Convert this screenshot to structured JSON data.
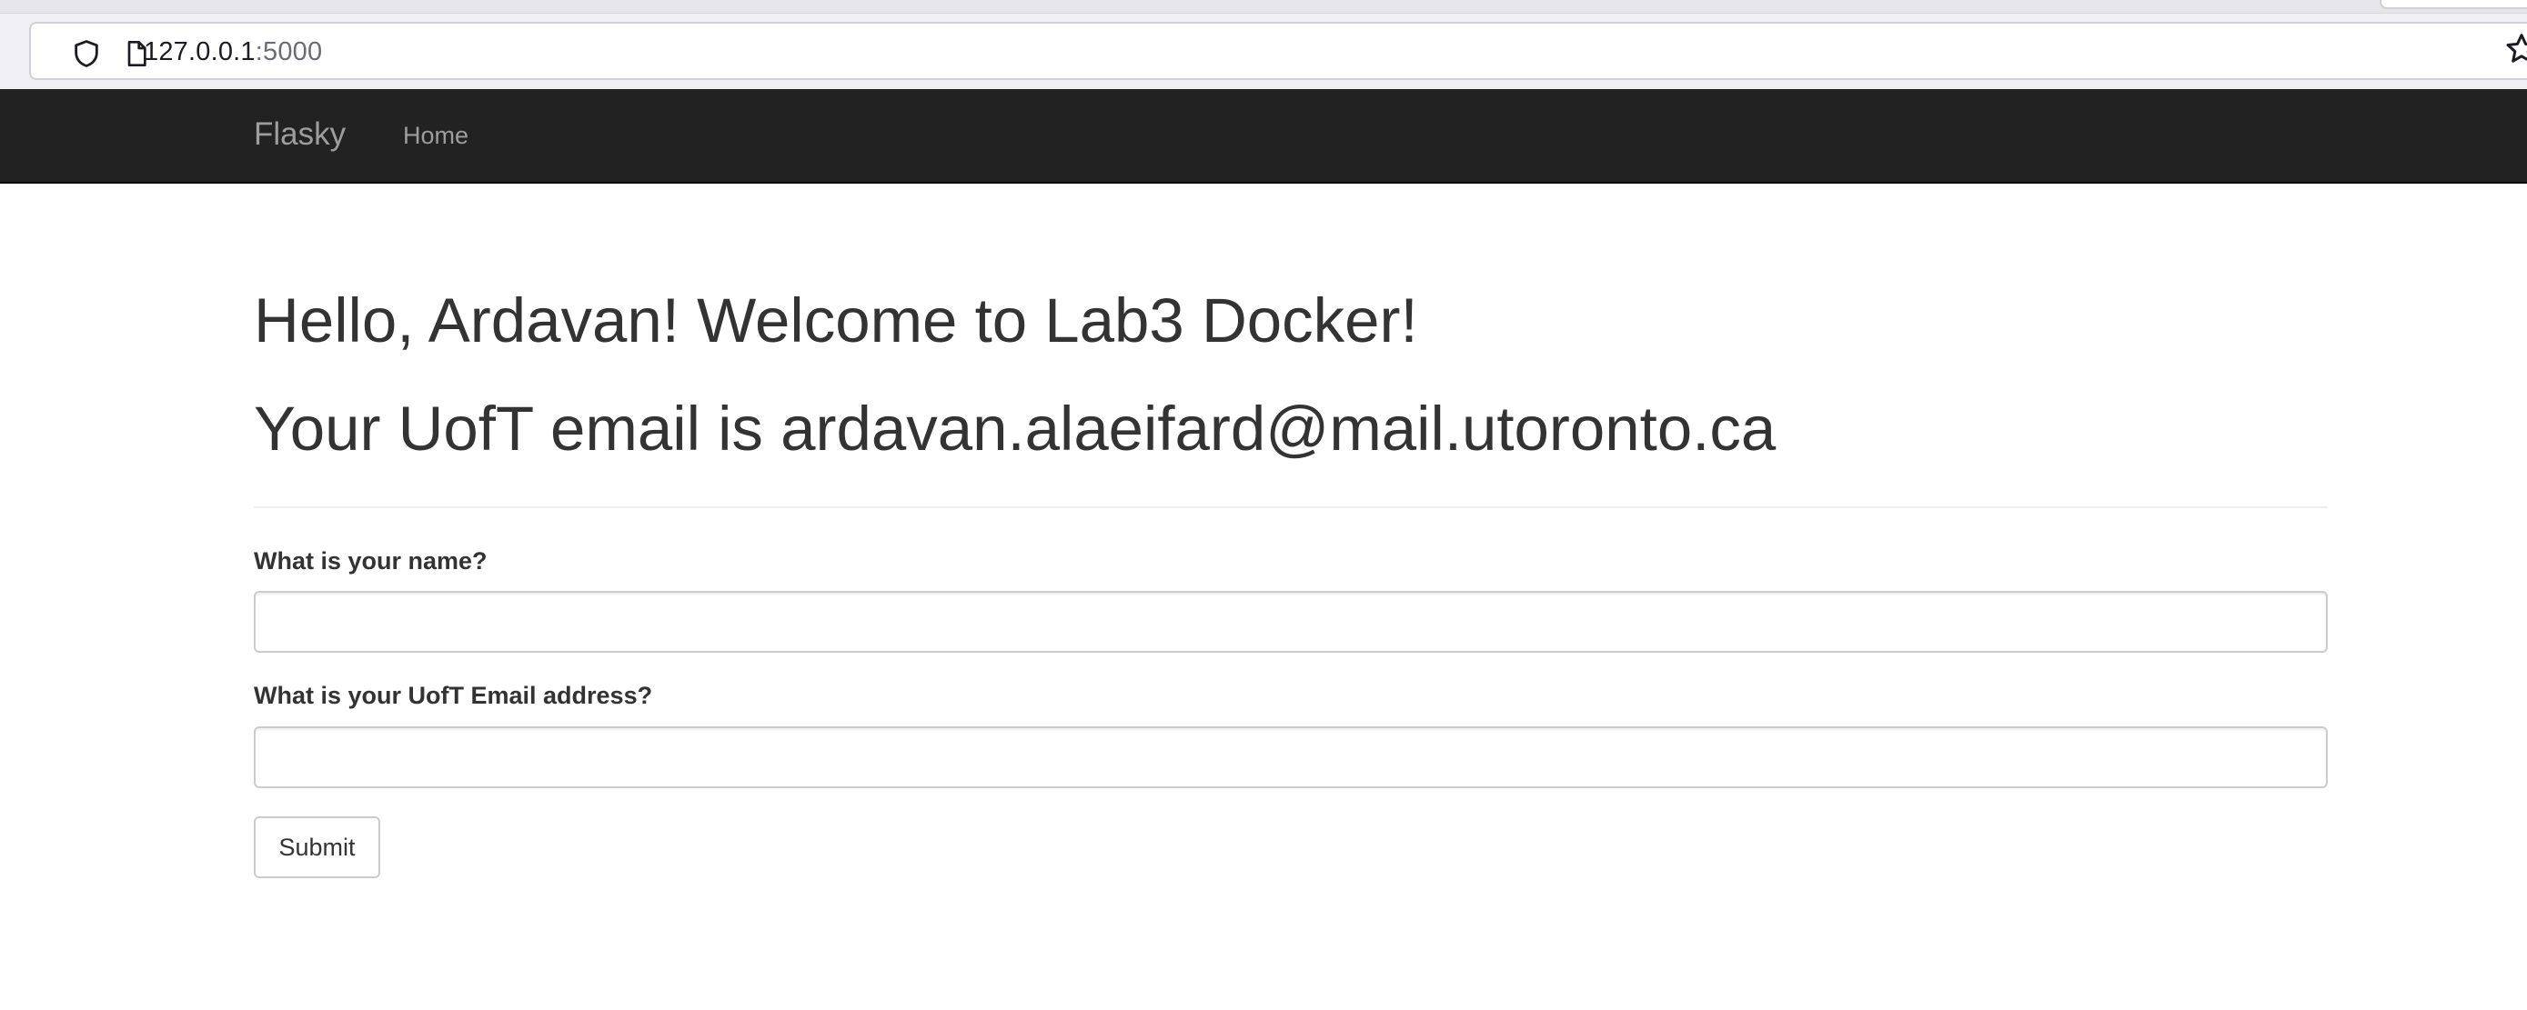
{
  "browser": {
    "url_host": "127.0.0.1",
    "url_port": ":5000"
  },
  "navbar": {
    "brand": "Flasky",
    "items": [
      {
        "label": "Home"
      }
    ]
  },
  "main": {
    "greeting": "Hello, Ardavan! Welcome to Lab3 Docker!",
    "email_line": "Your UofT email is ardavan.alaeifard@mail.utoronto.ca"
  },
  "form": {
    "name_label": "What is your name?",
    "name_value": "",
    "email_label": "What is your UofT Email address?",
    "email_value": "",
    "submit_label": "Submit"
  },
  "colors": {
    "navbar_bg": "#222222",
    "nav_text": "#9d9d9d",
    "body_text": "#333333",
    "input_border": "#cccccc"
  },
  "icons": [
    "shield-icon",
    "page-icon",
    "bookmark-star-icon"
  ]
}
